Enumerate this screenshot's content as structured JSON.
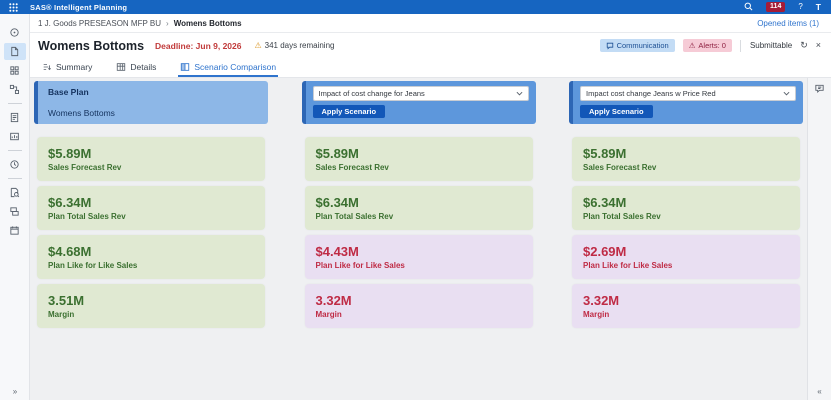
{
  "app": {
    "title": "SAS® Intelligent Planning",
    "notification_count": "114",
    "help_label": "?",
    "avatar_initial": "T"
  },
  "breadcrumb": {
    "root": "1 J. Goods PRESEASON MFP BU",
    "separator": "›",
    "current": "Womens Bottoms"
  },
  "opened_items_link": "Opened items (1)",
  "header": {
    "title": "Womens Bottoms",
    "deadline": "Deadline: Jun 9, 2026",
    "warning_icon": "⚠",
    "days_remaining": "341 days remaining",
    "communication": "Communication",
    "alerts": "Alerts: 0",
    "submittable": "Submittable",
    "refresh_icon": "↻",
    "close_icon": "×"
  },
  "tabs": [
    {
      "label": "Summary",
      "active": false
    },
    {
      "label": "Details",
      "active": false
    },
    {
      "label": "Scenario Comparison",
      "active": true
    }
  ],
  "columns": [
    {
      "kind": "base-plan",
      "title": "Base Plan",
      "subtitle": "Womens Bottoms",
      "metrics": [
        {
          "value": "$5.89M",
          "label": "Sales Forecast Rev",
          "tone": "positive"
        },
        {
          "value": "$6.34M",
          "label": "Plan Total Sales Rev",
          "tone": "positive"
        },
        {
          "value": "$4.68M",
          "label": "Plan Like for Like Sales",
          "tone": "positive"
        },
        {
          "value": "3.51M",
          "label": "Margin",
          "tone": "positive"
        }
      ]
    },
    {
      "kind": "scenario",
      "scenario_selected": "Impact of cost change for Jeans",
      "apply_button": "Apply Scenario",
      "metrics": [
        {
          "value": "$5.89M",
          "label": "Sales Forecast Rev",
          "tone": "positive"
        },
        {
          "value": "$6.34M",
          "label": "Plan Total Sales Rev",
          "tone": "positive"
        },
        {
          "value": "$4.43M",
          "label": "Plan Like for Like Sales",
          "tone": "negative"
        },
        {
          "value": "3.32M",
          "label": "Margin",
          "tone": "negative"
        }
      ]
    },
    {
      "kind": "scenario",
      "scenario_selected": "Impact cost change Jeans w Price Red",
      "apply_button": "Apply Scenario",
      "metrics": [
        {
          "value": "$5.89M",
          "label": "Sales Forecast Rev",
          "tone": "positive"
        },
        {
          "value": "$6.34M",
          "label": "Plan Total Sales Rev",
          "tone": "positive"
        },
        {
          "value": "$2.69M",
          "label": "Plan Like for Like Sales",
          "tone": "negative"
        },
        {
          "value": "3.32M",
          "label": "Margin",
          "tone": "negative"
        }
      ]
    }
  ],
  "sidebar": {
    "expand_icon": "»",
    "icons": [
      "explore-icon",
      "plan-document-icon",
      "grid-icon",
      "flows-icon",
      "document-icon",
      "chart-box-icon",
      "history-icon",
      "document-search-icon",
      "layers-icon",
      "schedule-icon"
    ]
  },
  "rail": {
    "collapse_icon": "«",
    "icon": "comment-icon"
  },
  "colors": {
    "topbar_blue": "#1665c1",
    "accent_blue": "#2f74cd",
    "badge_red": "#a51c38",
    "deadline_red": "#c13a3a",
    "warning_amber": "#dc9a2b",
    "base_card_blue": "#8db7e7",
    "scenario_card_blue": "#5d97dc",
    "apply_button_blue": "#1257b8",
    "positive_text": "#3b7030",
    "positive_bg": "#e0e9d2",
    "negative_text": "#bf2b45",
    "negative_bg": "#e9dff2",
    "communication_pill_bg": "#c3dcf5",
    "alerts_pill_bg": "#f6cbd6"
  }
}
